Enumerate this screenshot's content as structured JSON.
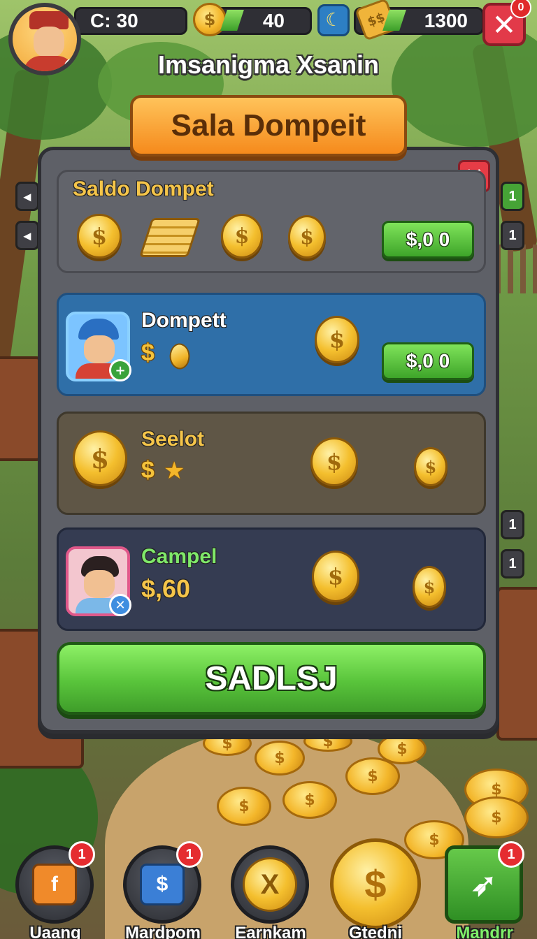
{
  "topbar": {
    "stat1": {
      "prefix": "C:",
      "value": "30"
    },
    "stat2": {
      "value": "40"
    },
    "stat3": {
      "value": "1300"
    },
    "close_badge": "0"
  },
  "player": {
    "name": "Imsanigma Xsanin"
  },
  "banner": {
    "title": "Sala Dompeit"
  },
  "panel": {
    "rows": [
      {
        "title": "Saldo Dompet",
        "title_color": "#f5c54a",
        "button_label": "$,0 0"
      },
      {
        "title": "Dompett",
        "title_color": "#ffffff",
        "button_label": "$,0 0"
      },
      {
        "title": "Seelot",
        "title_color": "#f5c54a"
      },
      {
        "title": "Campel",
        "title_color": "#7fe86a",
        "amount": "$,60"
      }
    ],
    "main_button": "SADLSJ"
  },
  "nav": [
    {
      "label": "Uaang",
      "badge": "1",
      "icon": "cube-icon"
    },
    {
      "label": "Mardpom",
      "badge": "1",
      "icon": "wallet-icon"
    },
    {
      "label": "Earnkam",
      "icon": "x-coin-icon"
    },
    {
      "label": "Gtedni",
      "icon": "dollar-coin-icon"
    },
    {
      "label": "Mandrr",
      "badge": "1",
      "icon": "feather-icon"
    }
  ],
  "colors": {
    "accent_orange": "#f58a1c",
    "button_green": "#59c43b",
    "row_blue": "#2f6fa8",
    "close_red": "#e23a49"
  }
}
